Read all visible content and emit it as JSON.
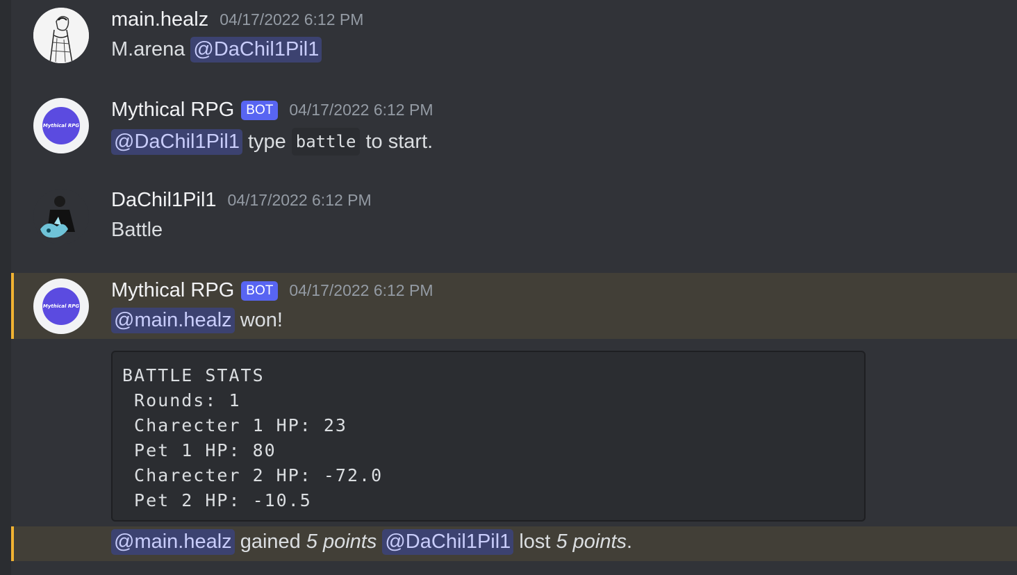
{
  "messages": [
    {
      "author": "main.healz",
      "timestamp": "04/17/2022 6:12 PM",
      "text": "M.arena",
      "mention": "@DaChil1Pil1"
    },
    {
      "author": "Mythical RPG",
      "bot_tag": "BOT",
      "timestamp": "04/17/2022 6:12 PM",
      "mention": "@DaChil1Pil1",
      "text_before_code": "type",
      "code": "battle",
      "text_after_code": "to start.",
      "avatar_label": "Mythical RPG"
    },
    {
      "author": "DaChil1Pil1",
      "timestamp": "04/17/2022 6:12 PM",
      "text": "Battle"
    },
    {
      "author": "Mythical RPG",
      "bot_tag": "BOT",
      "timestamp": "04/17/2022 6:12 PM",
      "mention": "@main.healz",
      "text": "won!",
      "avatar_label": "Mythical RPG"
    }
  ],
  "battle_stats": {
    "lines": [
      "BATTLE STATS",
      " Rounds: 1",
      " Charecter 1 HP: 23",
      " Pet 1 HP: 80",
      " Charecter 2 HP: -72.0",
      " Pet 2 HP: -10.5"
    ]
  },
  "result": {
    "mention_winner": "@main.healz",
    "gained": "gained",
    "points_gained": "5 points",
    "mention_loser": "@DaChil1Pil1",
    "lost": "lost",
    "points_lost": "5 points",
    "period": "."
  },
  "colors": {
    "background": "#313338",
    "highlight": "#423f37",
    "highlight_bar": "#f0b232",
    "mention_bg": "#3c4270",
    "bot_tag": "#5865f2"
  }
}
